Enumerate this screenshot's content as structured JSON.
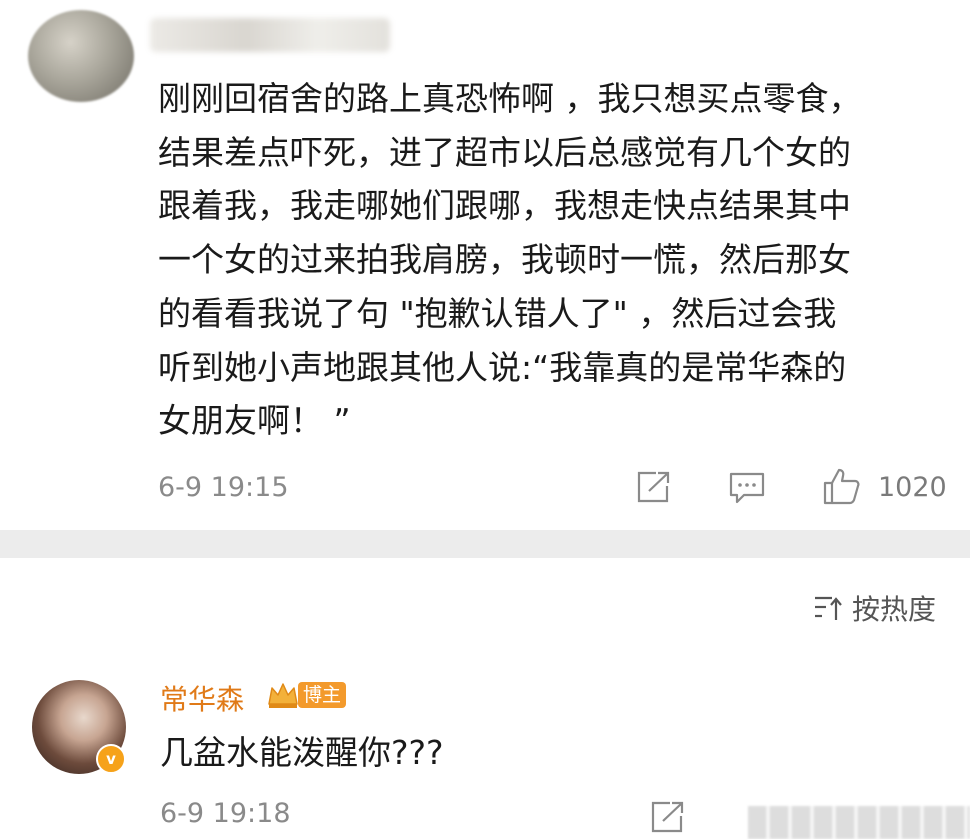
{
  "post": {
    "lines": [
      "刚刚回宿舍的路上真恐怖啊 ，我只想买点零食，",
      "结果差点吓死，进了超市以后总感觉有几个女的",
      "跟着我，我走哪她们跟哪，我想走快点结果其中",
      "一个女的过来拍我肩膀，我顿时一慌，然后那女",
      "的看看我说了句 \"抱歉认错人了\" ，然后过会我",
      "听到她小声地跟其他人说:“我靠真的是常华森的",
      "女朋友啊！ ”"
    ],
    "timestamp": "6-9 19:15",
    "like_count": "1020"
  },
  "sort": {
    "label": "按热度"
  },
  "comment": {
    "author": "常华森",
    "badge": "博主",
    "verified_mark": "v",
    "text": "几盆水能泼醒你???",
    "timestamp": "6-9 19:18"
  },
  "icons": [
    "share-icon",
    "comment-icon",
    "like-icon",
    "sort-icon",
    "crown-icon"
  ],
  "colors": {
    "author": "#e07a18",
    "badge": "#f39a2c",
    "separator": "#ececec",
    "meta": "#8a8a8a"
  }
}
